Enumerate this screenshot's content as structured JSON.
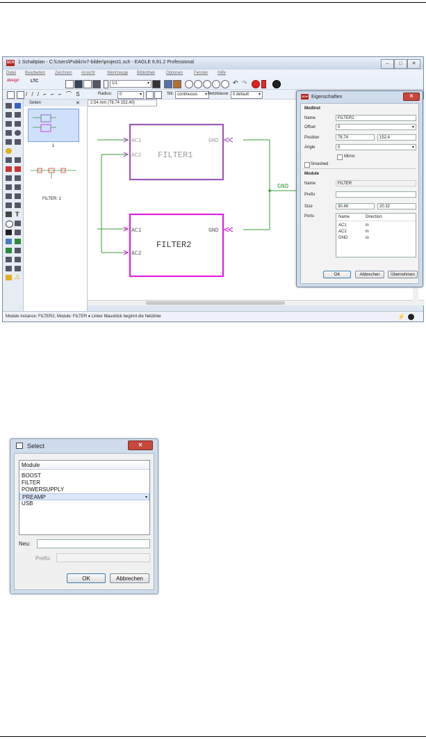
{
  "window": {
    "title": "1 Schaltplan - C:\\Users\\Public\\v7-bilder\\project1.sch - EAGLE 6.91.2 Professional",
    "icon_text": "SCH",
    "controls": [
      "–",
      "□",
      "✕"
    ]
  },
  "menu": [
    "Datei",
    "Bearbeiten",
    "Zeichnen",
    "Ansicht",
    "Werkzeuge",
    "Bibliothek",
    "Optionen",
    "Fenster",
    "Hilfe"
  ],
  "toolbar": {
    "sheet_select": "1/1",
    "design_link": "design",
    "ltc": "LTC",
    "radius_label": "Radius:",
    "radius_value": "0",
    "style_label": "Stil:",
    "style_value": "continuous",
    "netclass_label": "Netzklasse:",
    "netclass_value": "0 default"
  },
  "pages_panel": {
    "title": "Seiten",
    "page1_label": "1",
    "module_label": "FILTER: 1"
  },
  "canvas": {
    "coords": "2.54 mm (78.74 152.40)",
    "modules": [
      {
        "name": "FILTER1",
        "ports": [
          "AC1",
          "AC2",
          "GND"
        ],
        "color": "#9b59b6"
      },
      {
        "name": "FILTER2",
        "ports": [
          "AC1",
          "AC2",
          "GND"
        ],
        "color": "#e020e0"
      }
    ],
    "net_label": "GND",
    "wire_color": "#3a9a3a"
  },
  "status": {
    "text": "Module instance: FILTER2, Module: FILTER ♦ Linker Mausklick beginnt die Netzlinie"
  },
  "properties": {
    "title": "Eigenschaften",
    "modinst_header": "ModInst",
    "name_label": "Name",
    "name_value": "FILTER2",
    "offset_label": "Offset",
    "offset_value": "0",
    "position_label": "Position",
    "position_x": "78.74",
    "position_y": "152.4",
    "angle_label": "Angle",
    "angle_value": "0",
    "mirror_label": "Mirror",
    "smashed_label": "Smashed",
    "module_header": "Module",
    "mod_name_label": "Name",
    "mod_name_value": "FILTER",
    "prefix_label": "Prefix",
    "prefix_value": "",
    "size_label": "Size",
    "size_w": "30.48",
    "size_h": "20.32",
    "ports_label": "Ports",
    "ports_columns": [
      "Name",
      "Direction"
    ],
    "ports_rows": [
      {
        "name": "AC1",
        "direction": "in"
      },
      {
        "name": "AC2",
        "direction": "in"
      },
      {
        "name": "GND",
        "direction": "io"
      }
    ],
    "ok": "OK",
    "cancel": "Abbrechen",
    "apply": "Übernehmen"
  },
  "select_dialog": {
    "title": "Select",
    "column": "Module",
    "items": [
      "BOOST",
      "FILTER",
      "POWERSUPPLY",
      "PREAMP",
      "USB"
    ],
    "selected_index": 3,
    "new_label": "Neu:",
    "new_value": "",
    "prefix_label": "Prefix:",
    "prefix_value": "",
    "ok": "OK",
    "cancel": "Abbrechen"
  }
}
